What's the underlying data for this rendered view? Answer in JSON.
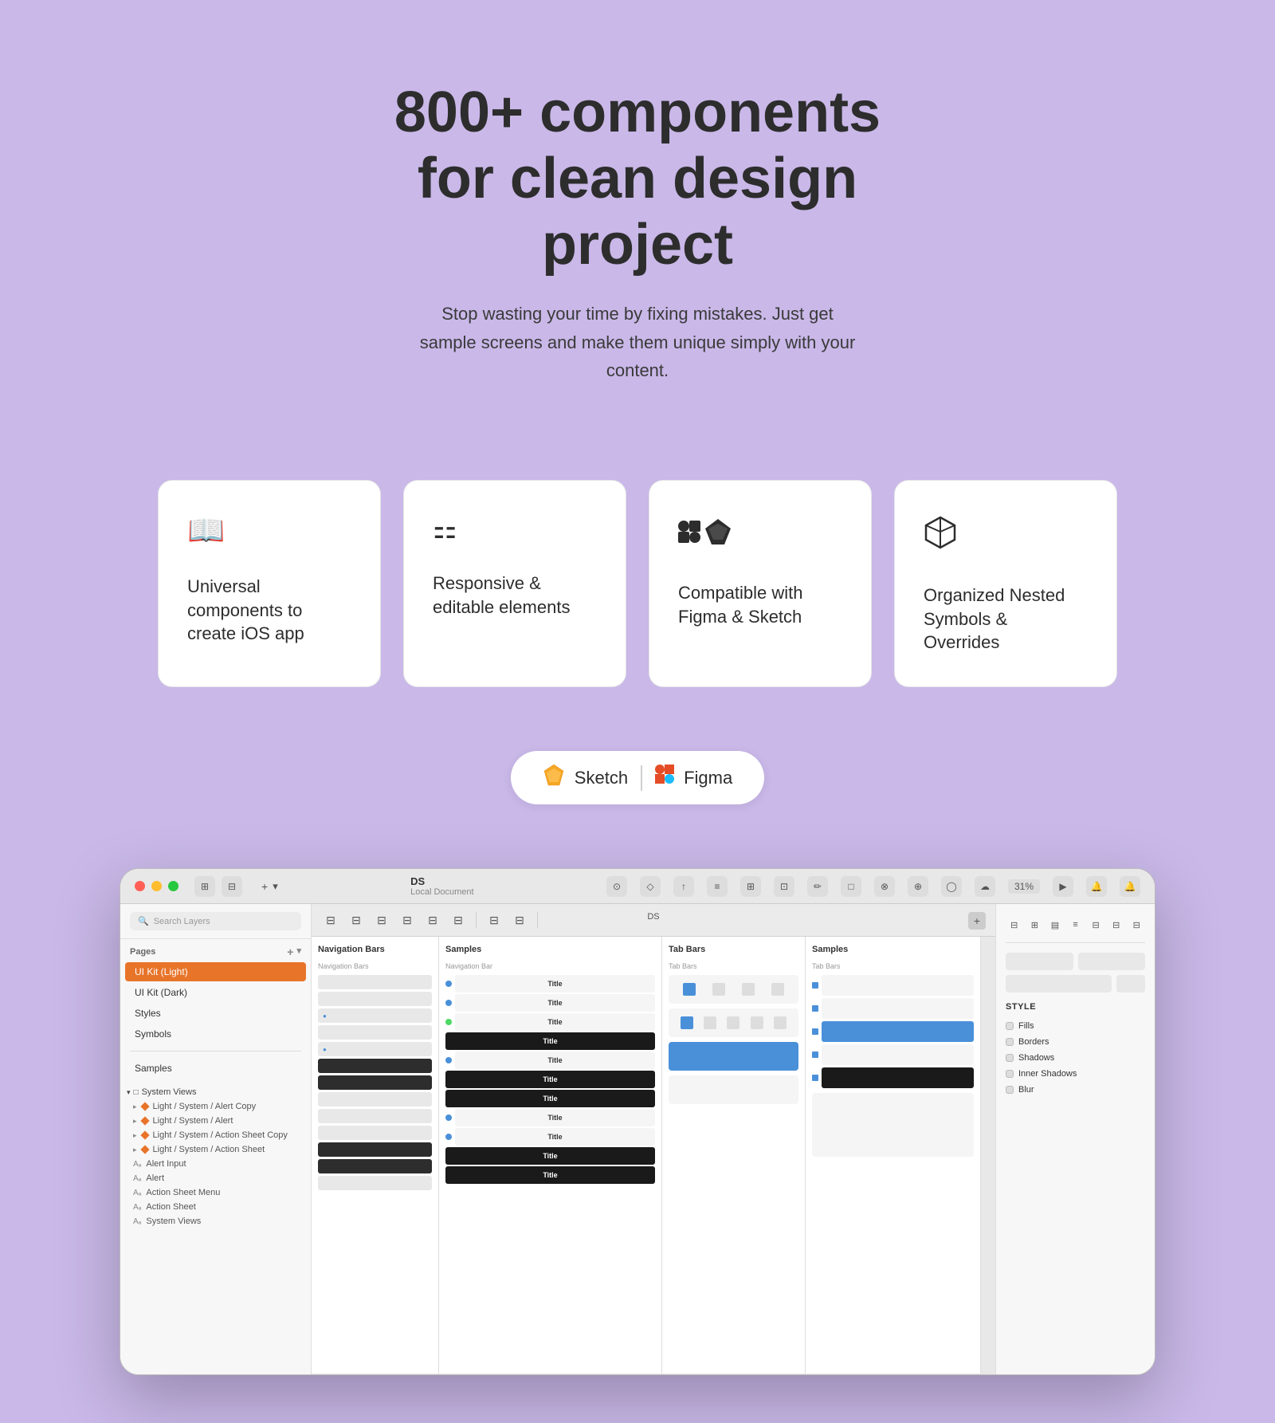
{
  "hero": {
    "title": "800+ components for clean design project",
    "subtitle": "Stop wasting your time by fixing mistakes. Just get sample screens and make them unique simply with your content."
  },
  "cards": [
    {
      "id": "card-universal",
      "icon": "📖",
      "icon_name": "book-icon",
      "text": "Universal components to create iOS app"
    },
    {
      "id": "card-responsive",
      "icon": "⚏",
      "icon_name": "grid-icon",
      "text": "Responsive & editable elements"
    },
    {
      "id": "card-compatible",
      "icon": "✦◇",
      "icon_name": "figma-sketch-icon",
      "text": "Compatible with Figma & Sketch"
    },
    {
      "id": "card-organized",
      "icon": "⬡",
      "icon_name": "cube-icon",
      "text": "Organized Nested Symbols & Overrides"
    }
  ],
  "tools": {
    "sketch_label": "Sketch",
    "figma_label": "Figma",
    "sketch_icon": "🟡",
    "figma_icon": "🔴"
  },
  "mockup": {
    "title": "DS",
    "subtitle": "Local Document",
    "zoom": "31%",
    "canvas_label": "DS",
    "pages": [
      {
        "label": "UI Kit (Light)",
        "active": true
      },
      {
        "label": "UI Kit (Dark)",
        "active": false
      },
      {
        "label": "Styles",
        "active": false
      },
      {
        "label": "Symbols",
        "active": false
      },
      {
        "label": "Samples",
        "active": false
      }
    ],
    "layers_section": "System Views",
    "layer_items": [
      {
        "label": "Light / System / Alert Copy",
        "type": "orange"
      },
      {
        "label": "Light / System / Alert",
        "type": "orange"
      },
      {
        "label": "Light / System / Action Sheet Copy",
        "type": "orange"
      },
      {
        "label": "Light / System / Action Sheet",
        "type": "orange"
      },
      {
        "label": "Alert Input",
        "type": "gray"
      },
      {
        "label": "Alert",
        "type": "gray"
      },
      {
        "label": "Action Sheet Menu",
        "type": "gray"
      },
      {
        "label": "Action Sheet",
        "type": "gray"
      },
      {
        "label": "System Views",
        "type": "gray"
      }
    ],
    "nav_bars_title": "Navigation Bars",
    "samples_title": "Samples",
    "tab_bars_title": "Tab Bars",
    "style_section": "STYLE",
    "style_items": [
      "Fills",
      "Borders",
      "Shadows",
      "Inner Shadows",
      "Blur"
    ]
  }
}
